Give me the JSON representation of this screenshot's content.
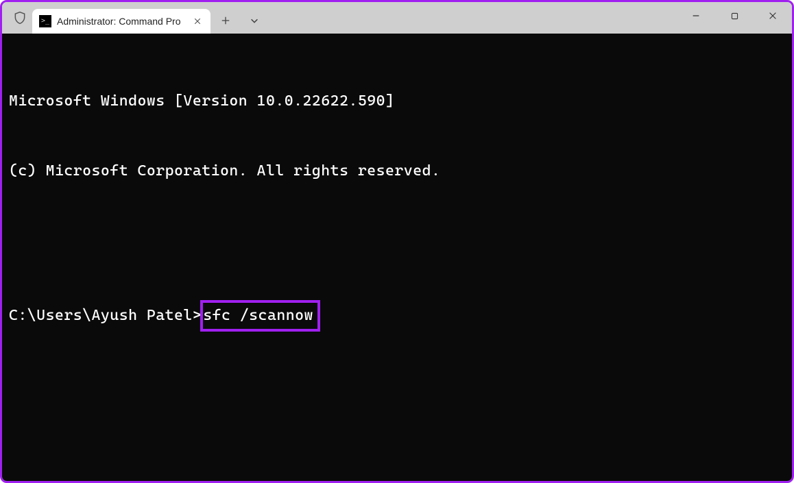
{
  "titlebar": {
    "tab_title": "Administrator: Command Pro",
    "tab_icon_glyph": ">_"
  },
  "terminal": {
    "line1": "Microsoft Windows [Version 10.0.22622.590]",
    "line2": "(c) Microsoft Corporation. All rights reserved.",
    "prompt": "C:\\Users\\Ayush Patel>",
    "command": "sfc /scannow"
  },
  "colors": {
    "accent": "#a020f0",
    "terminal_bg": "#0a0a0a",
    "terminal_fg": "#ffffff",
    "titlebar_bg": "#cfcfcf"
  }
}
